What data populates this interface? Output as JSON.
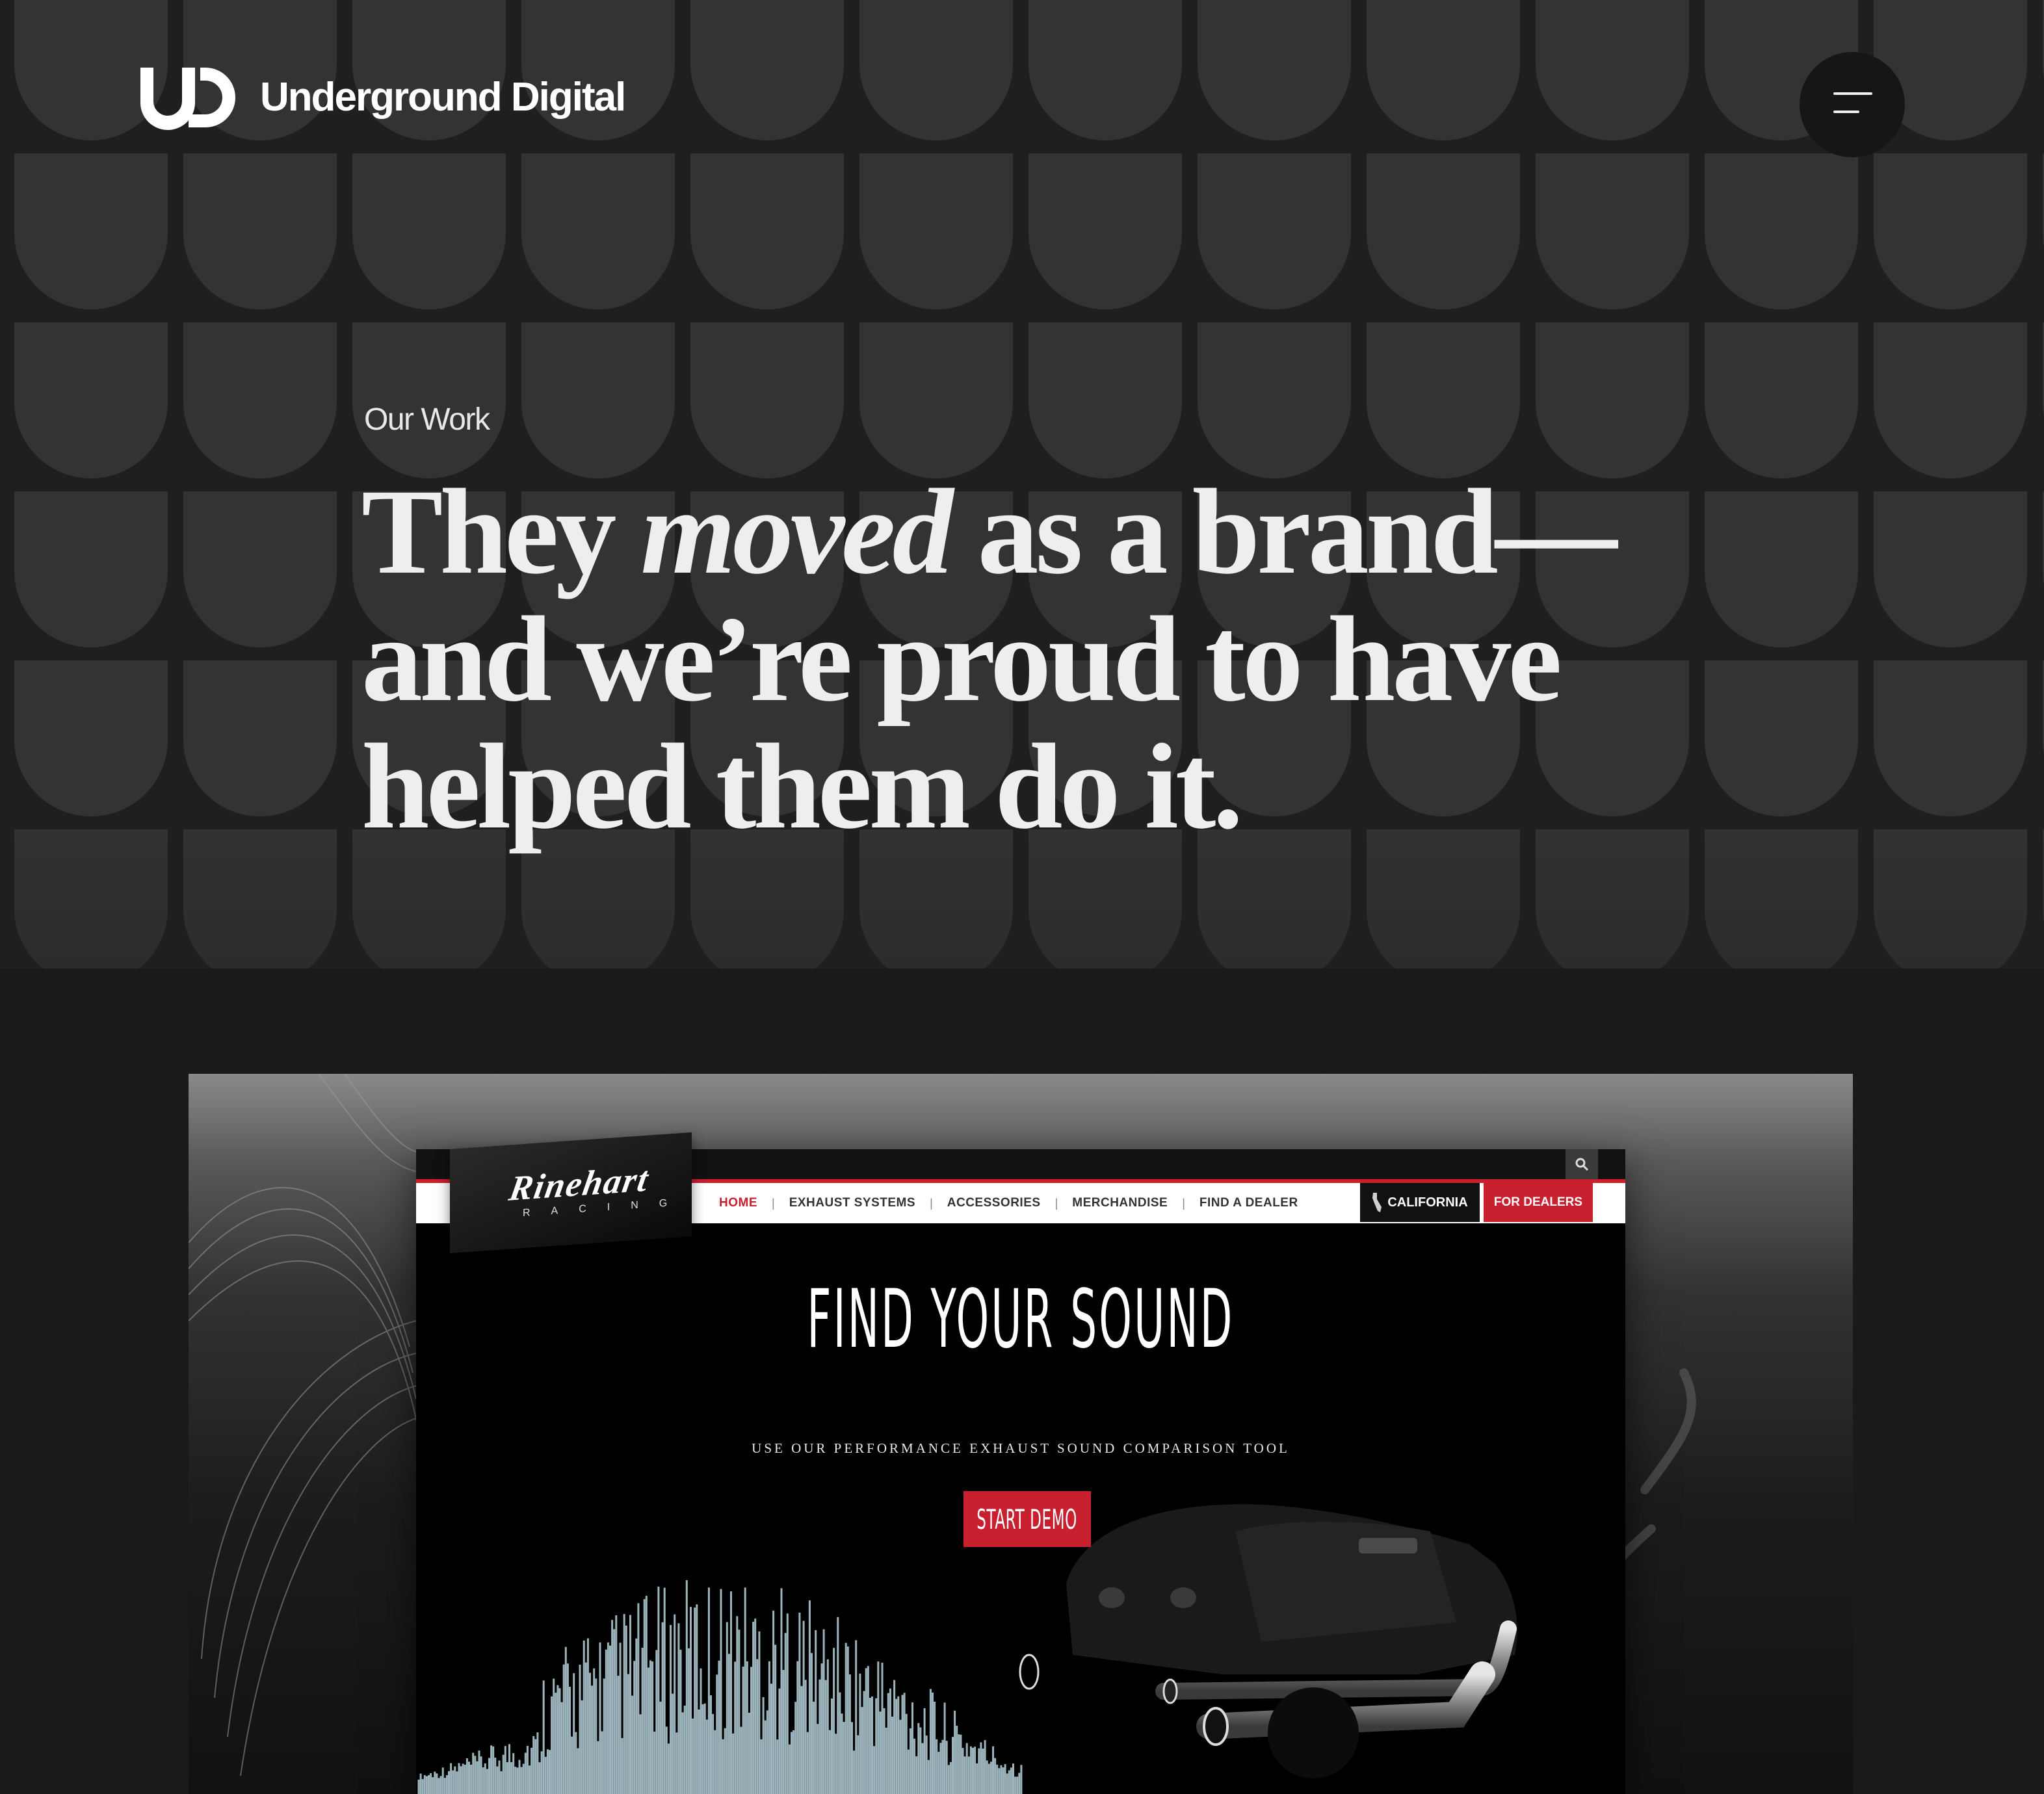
{
  "header": {
    "logo_mark_letters": "UD",
    "brand_name": "Underground Digital",
    "menu_icon": "hamburger-icon"
  },
  "hero": {
    "eyebrow": "Our Work",
    "headline_part1": "They ",
    "headline_emphasis": "moved",
    "headline_part2": " as a brand—and we’re proud to have helped them do it."
  },
  "showcase": {
    "site": {
      "brand": "Rinehart",
      "brand_sub": "RACING",
      "search_icon": "search-icon",
      "nav": [
        {
          "label": "HOME",
          "active": true
        },
        {
          "label": "EXHAUST SYSTEMS",
          "active": false
        },
        {
          "label": "ACCESSORIES",
          "active": false
        },
        {
          "label": "MERCHANDISE",
          "active": false
        },
        {
          "label": "FIND A DEALER",
          "active": false
        }
      ],
      "region_label": "CALIFORNIA",
      "region_icon": "california-map-icon",
      "dealers_label": "FOR DEALERS",
      "hero_title": "FIND YOUR SOUND",
      "hero_subtitle": "USE OUR PERFORMANCE EXHAUST SOUND COMPARISON TOOL",
      "cta_label": "START DEMO"
    }
  },
  "colors": {
    "page_bg": "#1a1a1a",
    "pattern_tile": "#333333",
    "accent_red": "#c8202f",
    "text_light": "#eeeeee"
  }
}
